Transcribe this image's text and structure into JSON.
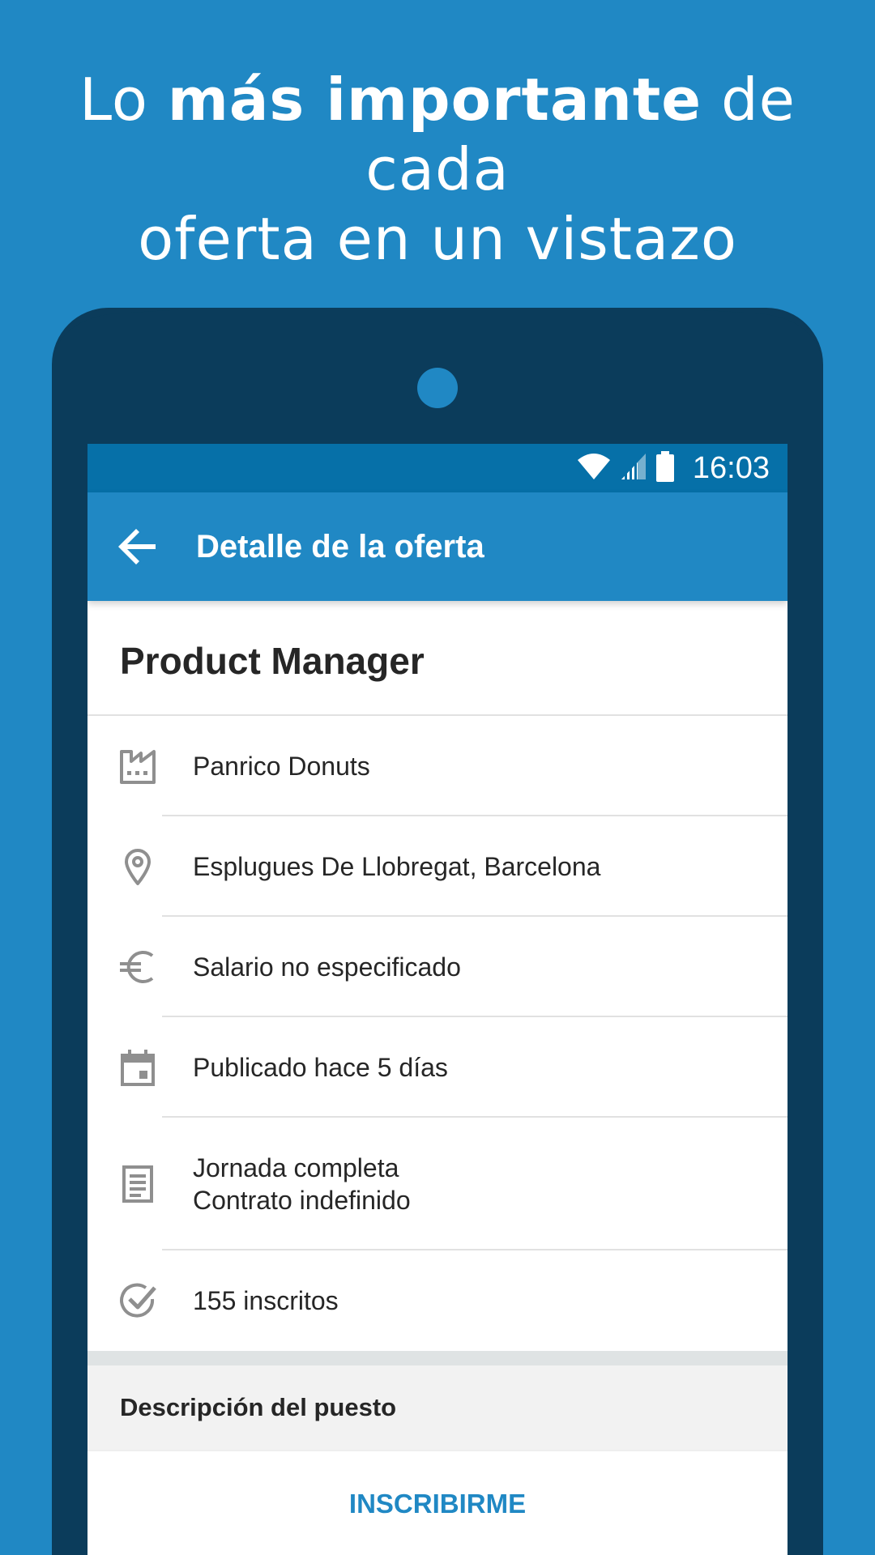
{
  "headline": {
    "line1_before": "Lo ",
    "line1_bold": "más importante",
    "line1_after": " de cada",
    "line2": "oferta en un vistazo"
  },
  "statusbar": {
    "time": "16:03",
    "icons": [
      "wifi-icon",
      "signal-icon",
      "battery-icon"
    ]
  },
  "appbar": {
    "back_icon": "arrow-left-icon",
    "title": "Detalle de la oferta"
  },
  "job": {
    "title": "Product Manager",
    "details": [
      {
        "icon": "factory-icon",
        "text": "Panrico Donuts"
      },
      {
        "icon": "location-pin-icon",
        "text": "Esplugues De Llobregat, Barcelona"
      },
      {
        "icon": "euro-icon",
        "text": "Salario no especificado"
      },
      {
        "icon": "calendar-icon",
        "text": "Publicado hace 5 días"
      },
      {
        "icon": "document-icon",
        "lines": [
          "Jornada completa",
          "Contrato indefinido"
        ]
      },
      {
        "icon": "check-circle-icon",
        "text": "155 inscritos"
      }
    ]
  },
  "section": {
    "header": "Descripción del puesto"
  },
  "cta": {
    "label": "INSCRIBIRME"
  },
  "colors": {
    "background": "#2088c4",
    "phone": "#0b3c5b",
    "statusbar": "#0670a8",
    "appbar": "#2088c4",
    "icon_gray": "#8f8f8f",
    "text": "#262626"
  }
}
